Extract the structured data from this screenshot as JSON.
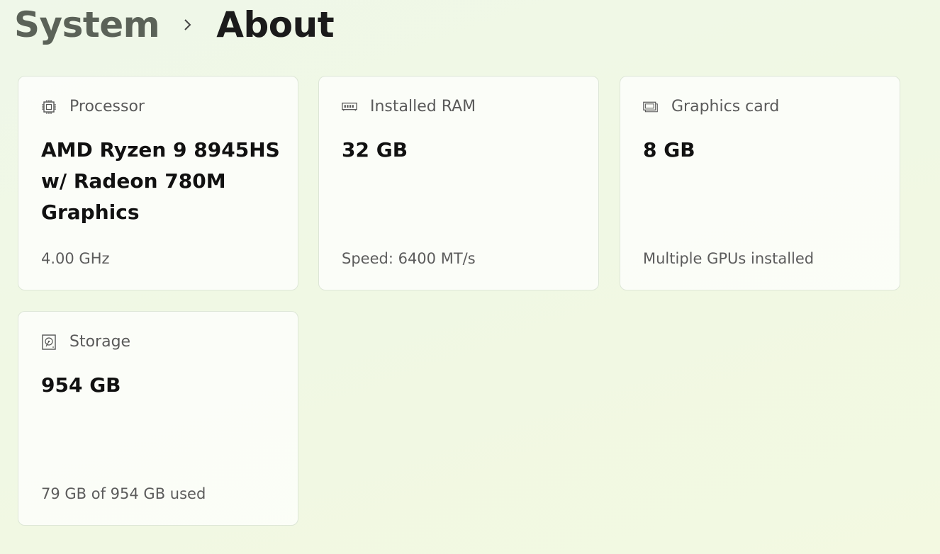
{
  "breadcrumb": {
    "parent": "System",
    "current": "About"
  },
  "cards": {
    "processor": {
      "icon": "cpu-icon",
      "label": "Processor",
      "value": "AMD Ryzen 9 8945HS w/ Radeon 780M Graphics",
      "detail": "4.00 GHz"
    },
    "ram": {
      "icon": "memory-icon",
      "label": "Installed RAM",
      "value": "32 GB",
      "detail": "Speed: 6400 MT/s"
    },
    "graphics": {
      "icon": "graphics-card-icon",
      "label": "Graphics card",
      "value": "8 GB",
      "detail": "Multiple GPUs installed"
    },
    "storage": {
      "icon": "hard-drive-icon",
      "label": "Storage",
      "value": "954 GB",
      "detail": "79 GB of 954 GB used"
    }
  },
  "colors": {
    "parent_text": "#5b6258",
    "current_text": "#1b1b1b",
    "card_border": "#dde6d7"
  }
}
